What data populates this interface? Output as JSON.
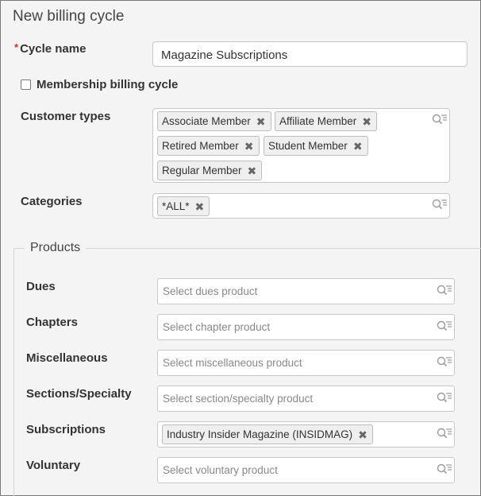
{
  "dialog": {
    "title": "New billing cycle"
  },
  "cycle_name": {
    "required_mark": "*",
    "label": "Cycle name",
    "value": "Magazine Subscriptions"
  },
  "membership": {
    "label": "Membership billing cycle",
    "checked": false
  },
  "customer_types": {
    "label": "Customer types",
    "tags": [
      "Associate Member",
      "Affiliate Member",
      "Retired Member",
      "Student Member",
      "Regular Member"
    ]
  },
  "categories": {
    "label": "Categories",
    "tags": [
      "*ALL*"
    ]
  },
  "products": {
    "legend": "Products",
    "dues": {
      "label": "Dues",
      "placeholder": "Select dues product"
    },
    "chapters": {
      "label": "Chapters",
      "placeholder": "Select chapter product"
    },
    "misc": {
      "label": "Miscellaneous",
      "placeholder": "Select miscellaneous product"
    },
    "sections": {
      "label": "Sections/Specialty",
      "placeholder": "Select section/specialty product"
    },
    "subscriptions": {
      "label": "Subscriptions",
      "tags": [
        "Industry Insider Magazine (INSIDMAG)"
      ]
    },
    "voluntary": {
      "label": "Voluntary",
      "placeholder": "Select voluntary product"
    }
  },
  "tag_remove_glyph": "✖",
  "icons": {
    "lookup": "search-list-icon"
  },
  "colors": {
    "required": "#c0392b",
    "tag_bg": "#efefef",
    "border": "#c8c8c8"
  }
}
